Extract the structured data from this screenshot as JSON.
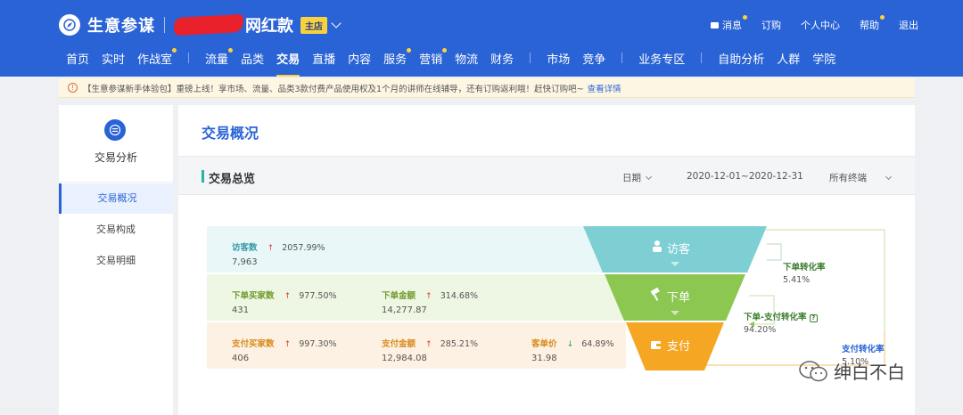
{
  "header": {
    "brand": "生意参谋",
    "shop_name": "网红款",
    "shop_badge": "主店",
    "topright": [
      {
        "label": "消息",
        "dot": true
      },
      {
        "label": "订购",
        "dot": false
      },
      {
        "label": "个人中心",
        "dot": false
      },
      {
        "label": "帮助",
        "dot": true
      },
      {
        "label": "退出",
        "dot": false
      }
    ],
    "nav": [
      {
        "label": "首页"
      },
      {
        "label": "实时"
      },
      {
        "label": "作战室",
        "dot": true
      },
      {
        "label": "流量",
        "dot": true
      },
      {
        "label": "品类"
      },
      {
        "label": "交易",
        "active": true
      },
      {
        "label": "直播"
      },
      {
        "label": "内容"
      },
      {
        "label": "服务",
        "dot": true
      },
      {
        "label": "营销",
        "dot": true
      },
      {
        "label": "物流"
      },
      {
        "label": "财务"
      },
      {
        "label": "市场"
      },
      {
        "label": "竞争"
      },
      {
        "label": "业务专区"
      },
      {
        "label": "自助分析"
      },
      {
        "label": "人群"
      },
      {
        "label": "学院"
      }
    ]
  },
  "notice": {
    "text": "【生意参谋新手体验包】重磅上线！享市场、流量、品类3款付费产品使用权及1个月的讲师在线辅导，还有订购返利哦！赶快订购吧~",
    "link": "查看详情"
  },
  "sidebar": {
    "title": "交易分析",
    "items": [
      {
        "label": "交易概况",
        "active": true
      },
      {
        "label": "交易构成"
      },
      {
        "label": "交易明细"
      }
    ]
  },
  "main": {
    "title": "交易概况",
    "section_title": "交易总览",
    "filters": {
      "date_label": "日期",
      "date_range": "2020-12-01~2020-12-31",
      "terminal": "所有终端"
    },
    "rows": [
      [
        {
          "label": "访客数",
          "change": "2057.99%",
          "trend": "up",
          "value": "7,963"
        }
      ],
      [
        {
          "label": "下单买家数",
          "change": "977.50%",
          "trend": "up",
          "value": "431"
        },
        {
          "label": "下单金额",
          "change": "314.68%",
          "trend": "up",
          "value": "14,277.87"
        }
      ],
      [
        {
          "label": "支付买家数",
          "change": "997.30%",
          "trend": "up",
          "value": "406"
        },
        {
          "label": "支付金额",
          "change": "285.21%",
          "trend": "up",
          "value": "12,984.08"
        },
        {
          "label": "客单价",
          "change": "64.89%",
          "trend": "down",
          "value": "31.98"
        }
      ]
    ],
    "funnel": {
      "stages": [
        "访客",
        "下单",
        "支付"
      ],
      "colors": [
        "#7dcfd3",
        "#8cc751",
        "#f5a623"
      ],
      "conversions": [
        {
          "label": "下单转化率",
          "value": "5.41%"
        },
        {
          "label": "下单-支付转化率",
          "value": "94.20%"
        },
        {
          "label": "支付转化率",
          "value": "5.10%"
        }
      ]
    }
  },
  "watermark": "绅白不白"
}
